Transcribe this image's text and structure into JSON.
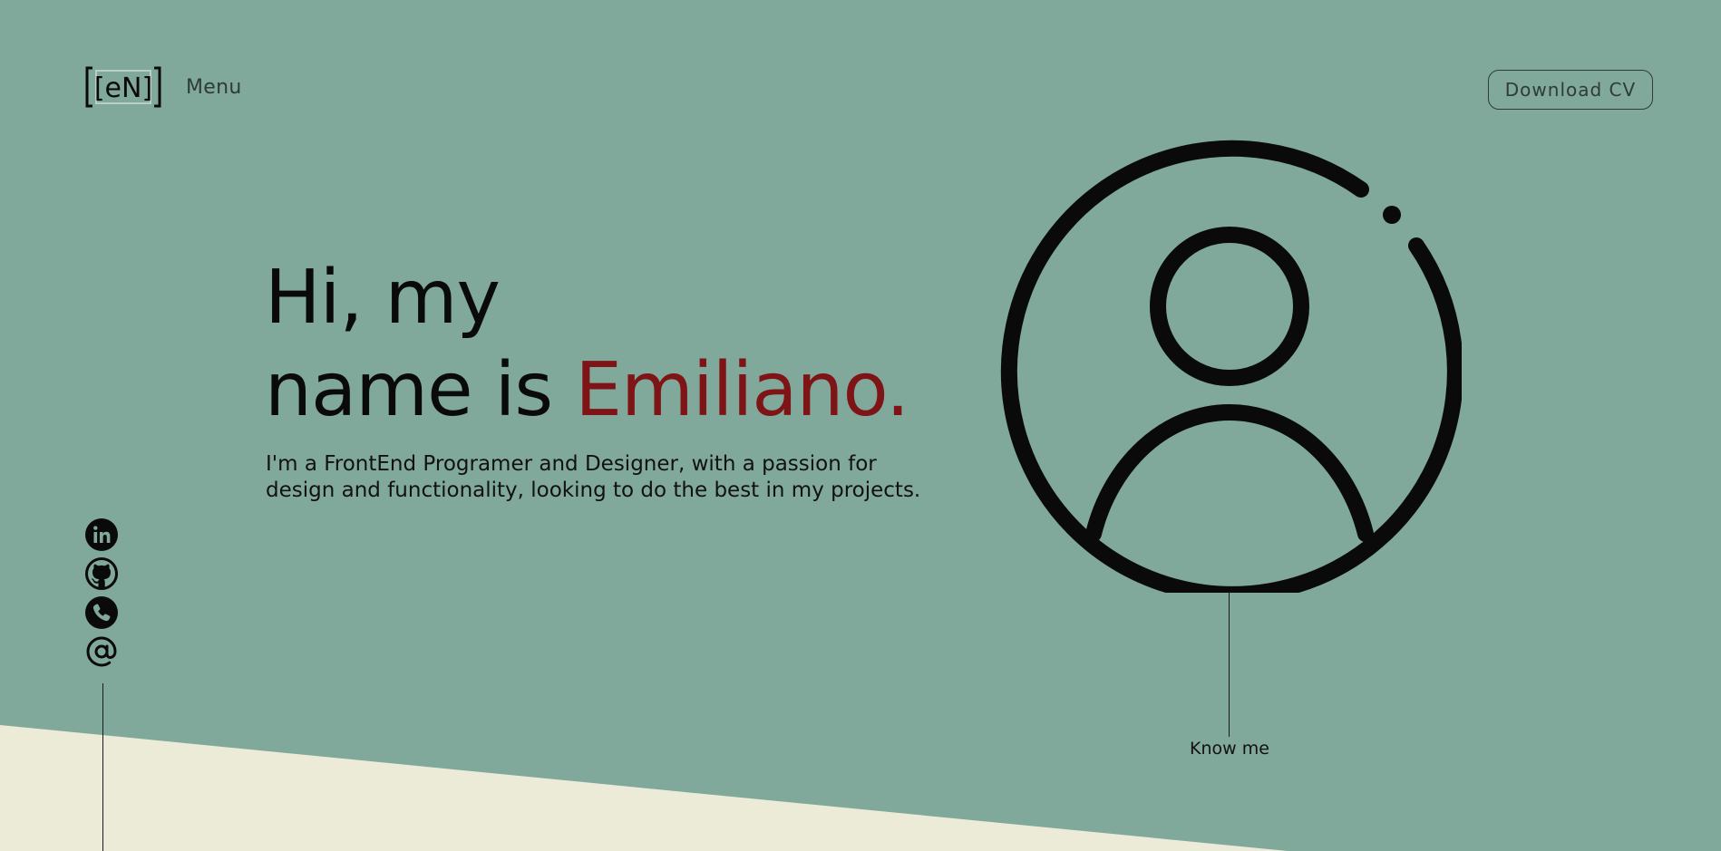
{
  "header": {
    "logo_text": "[eN]",
    "menu_label": "Menu",
    "cv_button_label": "Download CV"
  },
  "hero": {
    "line1": "Hi, my",
    "line2_prefix": "name is ",
    "name": "Emiliano.",
    "description": "I'm a FrontEnd Programer and Designer, with a passion for design and functionality, looking to do the best in my projects."
  },
  "cta": {
    "know_me_label": "Know me"
  },
  "socials": [
    {
      "icon": "linkedin-icon"
    },
    {
      "icon": "github-icon"
    },
    {
      "icon": "phone-icon"
    },
    {
      "icon": "at-sign-icon"
    }
  ],
  "colors": {
    "background": "#80a99b",
    "bottom_band": "#ecebd8",
    "accent_name": "#7f1416",
    "text": "#0a0a0a"
  }
}
